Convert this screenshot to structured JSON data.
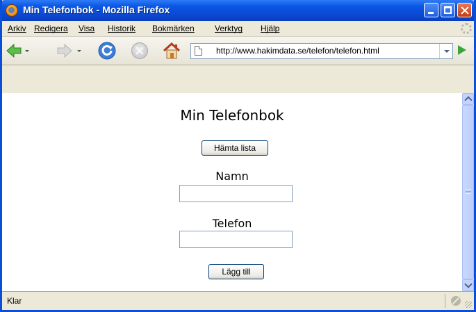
{
  "window": {
    "title": "Min Telefonbok - Mozilla Firefox"
  },
  "menu": {
    "items": [
      "Arkiv",
      "Redigera",
      "Visa",
      "Historik",
      "Bokmärken",
      "Verktyg",
      "Hjälp"
    ]
  },
  "toolbar": {
    "back_icon": "back-arrow-icon",
    "forward_icon": "forward-arrow-icon",
    "reload_icon": "reload-icon",
    "stop_icon": "stop-icon",
    "home_icon": "home-icon",
    "go_icon": "go-icon",
    "url": "http://www.hakimdata.se/telefon/telefon.html"
  },
  "page": {
    "title": "Min Telefonbok",
    "fetch_button": "Hämta lista",
    "name_label": "Namn",
    "name_value": "",
    "phone_label": "Telefon",
    "phone_value": "",
    "add_button": "Lägg till"
  },
  "status": {
    "text": "Klar"
  },
  "colors": {
    "titlebar": "#0b4fe0",
    "chrome": "#ece9d8",
    "go_green": "#3aa63a"
  }
}
